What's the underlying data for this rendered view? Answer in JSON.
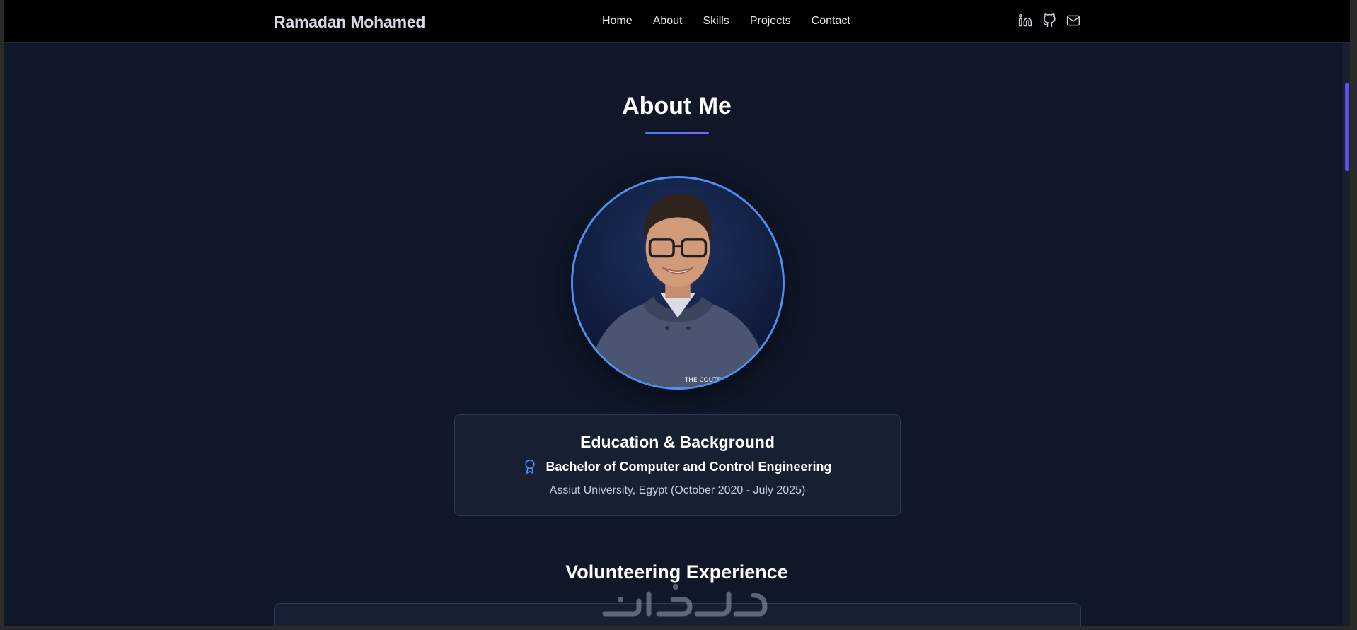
{
  "navbar": {
    "brand": "Ramadan Mohamed",
    "links": [
      "Home",
      "About",
      "Skills",
      "Projects",
      "Contact"
    ],
    "icons": [
      "linkedin-icon",
      "github-icon",
      "mail-icon"
    ]
  },
  "about": {
    "title": "About Me",
    "avatar_alt": "Profile photo",
    "education": {
      "title": "Education & Background",
      "degree": "Bachelor of Computer and Control Engineering",
      "institution": "Assiut University, Egypt (October 2020 - July 2025)"
    }
  },
  "volunteering": {
    "title": "Volunteering Experience"
  },
  "colors": {
    "background": "#0f1729",
    "navbar": "#000000",
    "accent_blue": "#3b82f6",
    "accent_purple": "#8b5cf6",
    "card": "#172033"
  }
}
